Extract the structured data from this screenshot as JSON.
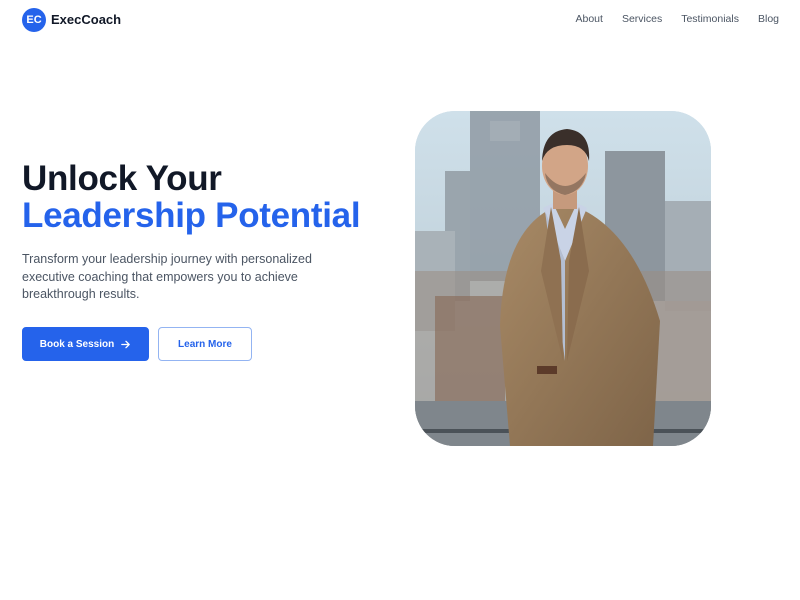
{
  "brand": {
    "logo_initials": "EC",
    "name": "ExecCoach",
    "accent_color": "#2563eb"
  },
  "nav": {
    "items": [
      {
        "label": "About"
      },
      {
        "label": "Services"
      },
      {
        "label": "Testimonials"
      },
      {
        "label": "Blog"
      }
    ]
  },
  "hero": {
    "title_line1": "Unlock Your",
    "title_line2": "Leadership Potential",
    "subtitle": "Transform your leadership journey with personalized executive coaching that empowers you to achieve breakthrough results.",
    "primary_button": {
      "label": "Book a Session",
      "icon": "arrow-right-icon"
    },
    "secondary_button": {
      "label": "Learn More"
    },
    "image": {
      "subject": "executive-coach-portrait"
    }
  }
}
